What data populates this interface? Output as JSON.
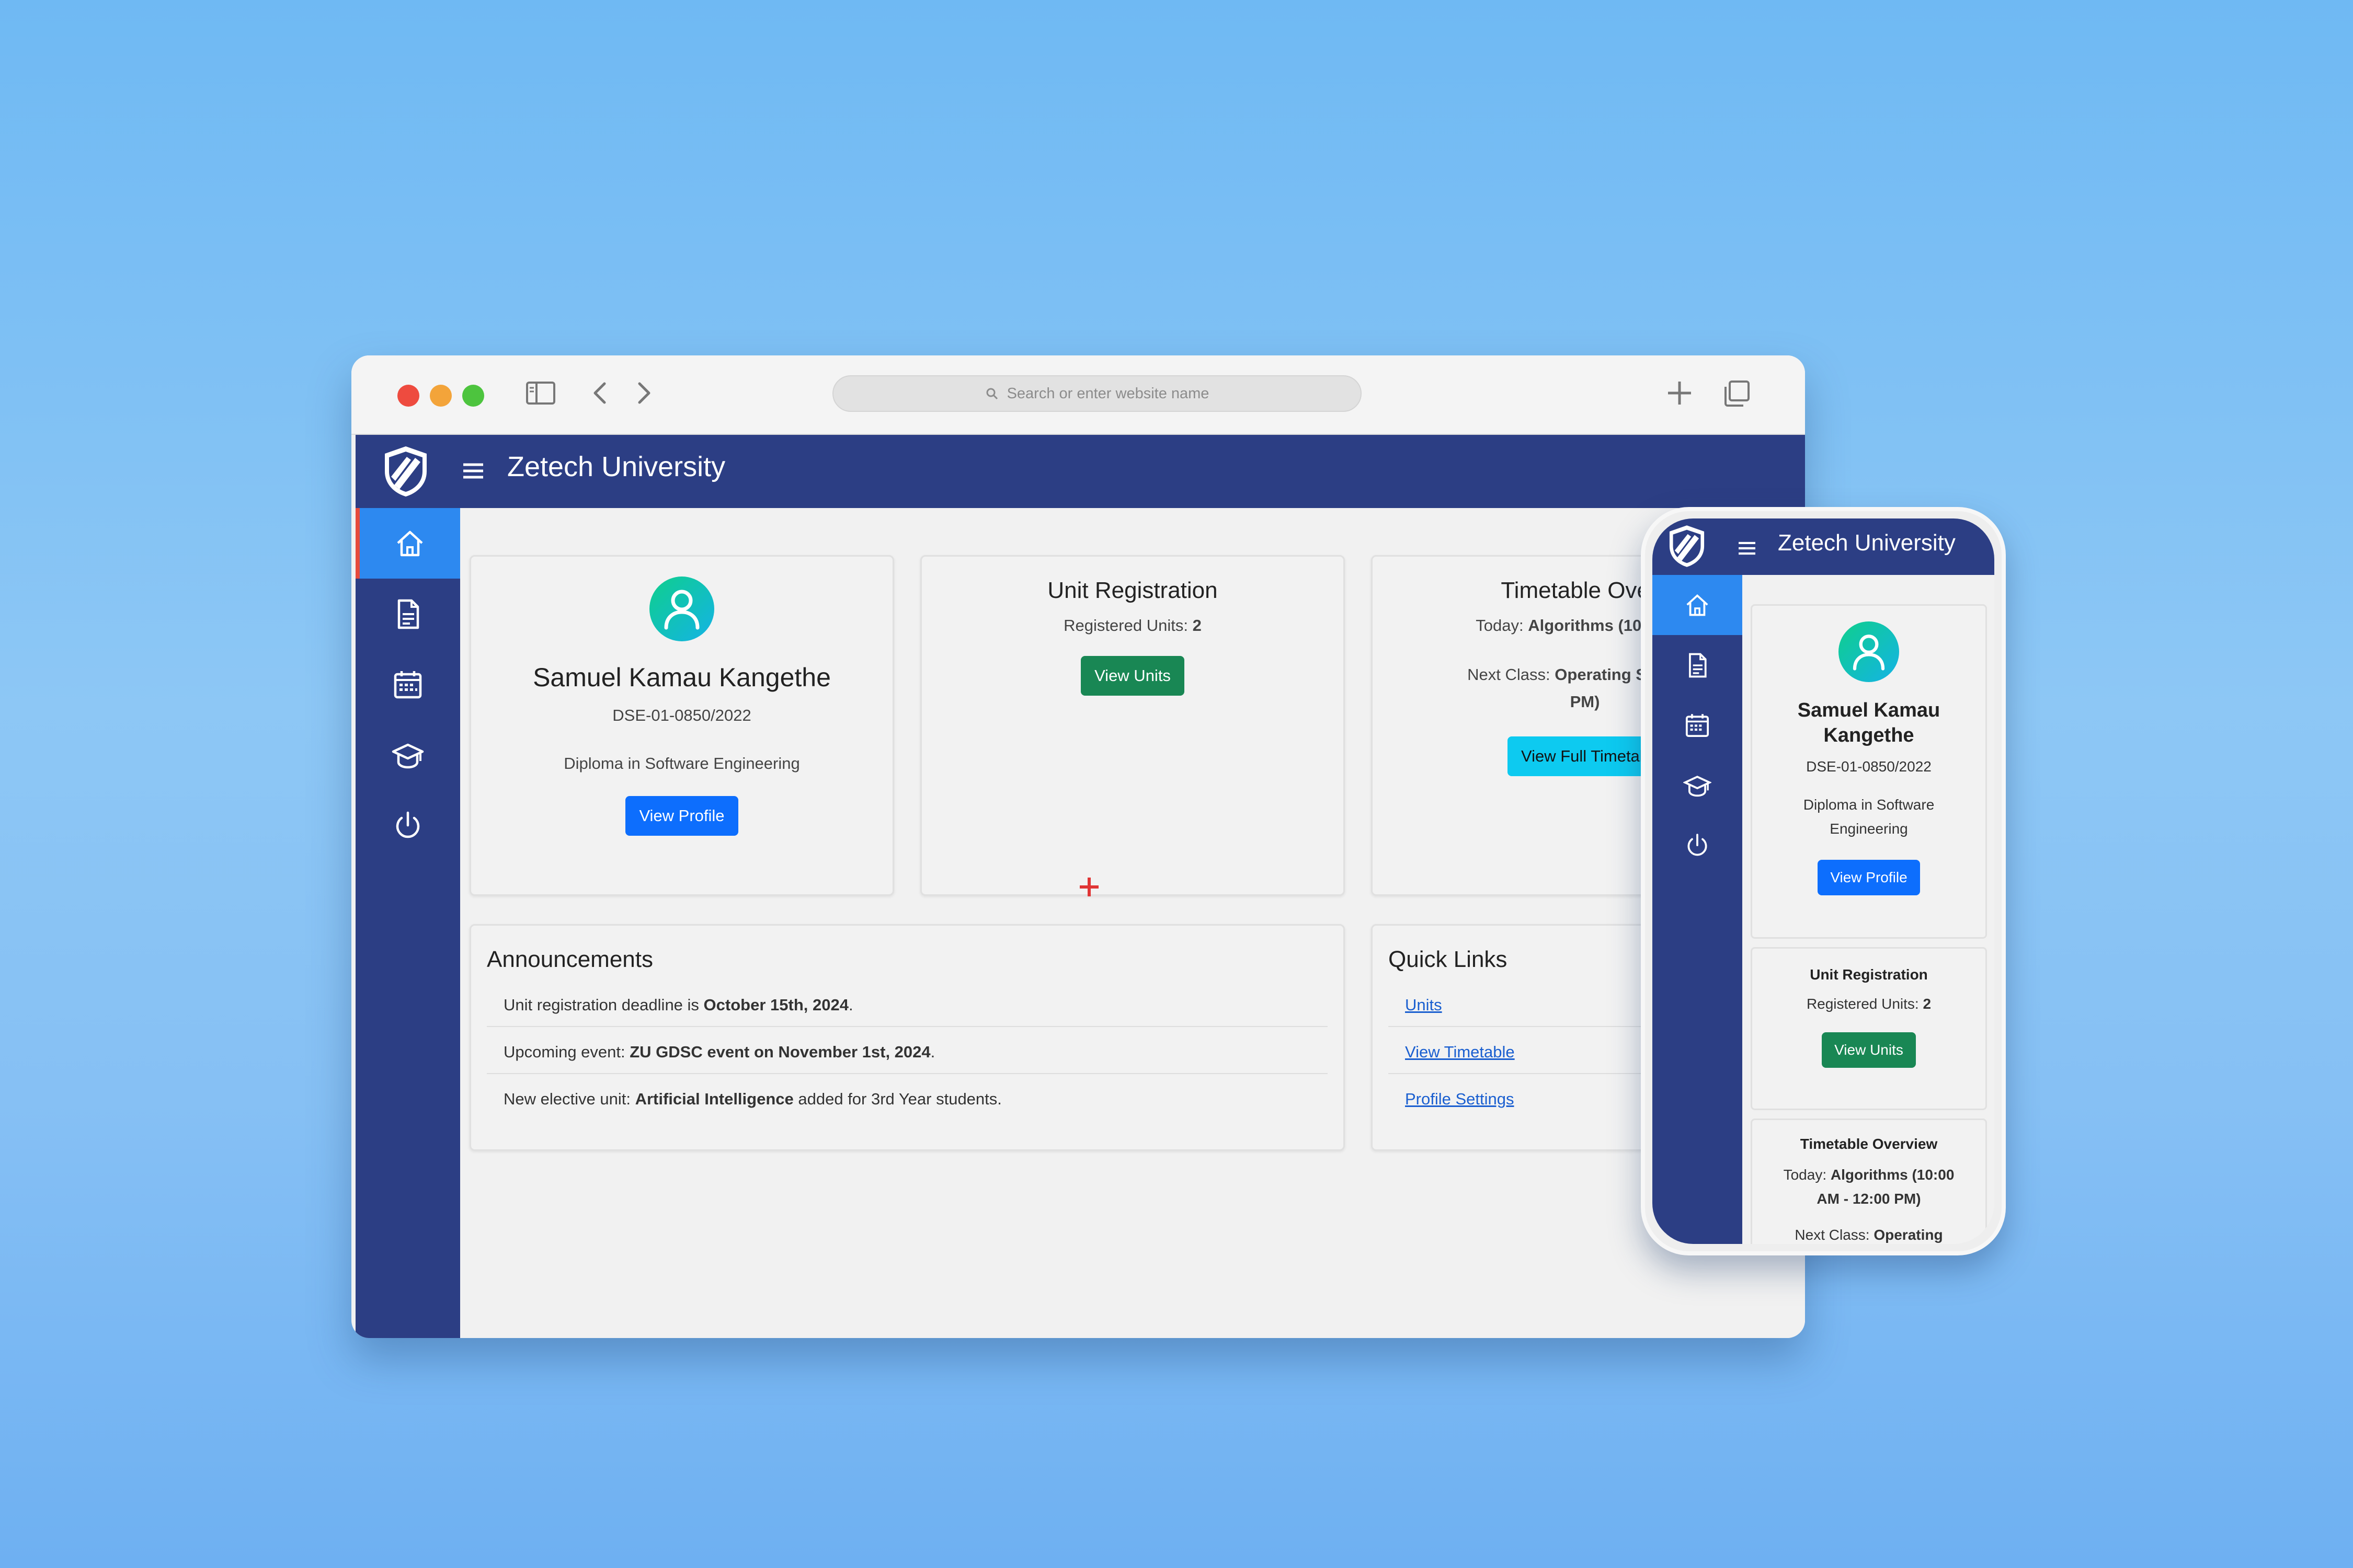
{
  "browser": {
    "address_placeholder": "Search or enter website name"
  },
  "app": {
    "title": "Zetech University",
    "profile": {
      "name": "Samuel Kamau Kangethe",
      "reg_no": "DSE-01-0850/2022",
      "course": "Diploma in Software Engineering",
      "button": "View Profile"
    },
    "unit_registration": {
      "title": "Unit Registration",
      "label": "Registered Units:",
      "count": "2",
      "button": "View Units"
    },
    "timetable": {
      "title": "Timetable Overv",
      "today_label": "Today:",
      "today_value": "Algorithms (10:00 AM",
      "next_label": "Next Class:",
      "next_value": "Operating Systems",
      "next_value_2": "PM)",
      "button": "View Full Timetab"
    },
    "announcements": {
      "title": "Announcements",
      "items": [
        {
          "pre": "Unit registration deadline is ",
          "bold": "October 15th, 2024",
          "post": "."
        },
        {
          "pre": "Upcoming event: ",
          "bold": "ZU GDSC event on November 1st, 2024",
          "post": "."
        },
        {
          "pre": "New elective unit: ",
          "bold": "Artificial Intelligence",
          "post": " added for 3rd Year students."
        }
      ]
    },
    "quick_links": {
      "title": "Quick Links",
      "items": [
        "Units",
        "View Timetable",
        "Profile Settings"
      ]
    },
    "sidebar_icons": [
      "home-icon",
      "document-icon",
      "calendar-icon",
      "graduation-cap-icon",
      "power-icon"
    ]
  },
  "mobile": {
    "title": "Zetech University",
    "profile": {
      "name": "Samuel Kamau Kangethe",
      "reg_no": "DSE-01-0850/2022",
      "course": "Diploma in Software Engineering",
      "button": "View Profile"
    },
    "unit_registration": {
      "title": "Unit Registration",
      "label": "Registered Units:",
      "count": "2",
      "button": "View Units"
    },
    "timetable": {
      "title": "Timetable Overview",
      "today_label": "Today:",
      "today_value": "Algorithms (10:00 AM - 12:00 PM)",
      "next_label": "Next Class:",
      "next_value": "Operating"
    }
  },
  "colors": {
    "navy": "#2c3e84",
    "active_blue": "#2d89f0",
    "primary_button": "#0d6efd",
    "success_button": "#198754",
    "info_button": "#0dcaf0"
  }
}
